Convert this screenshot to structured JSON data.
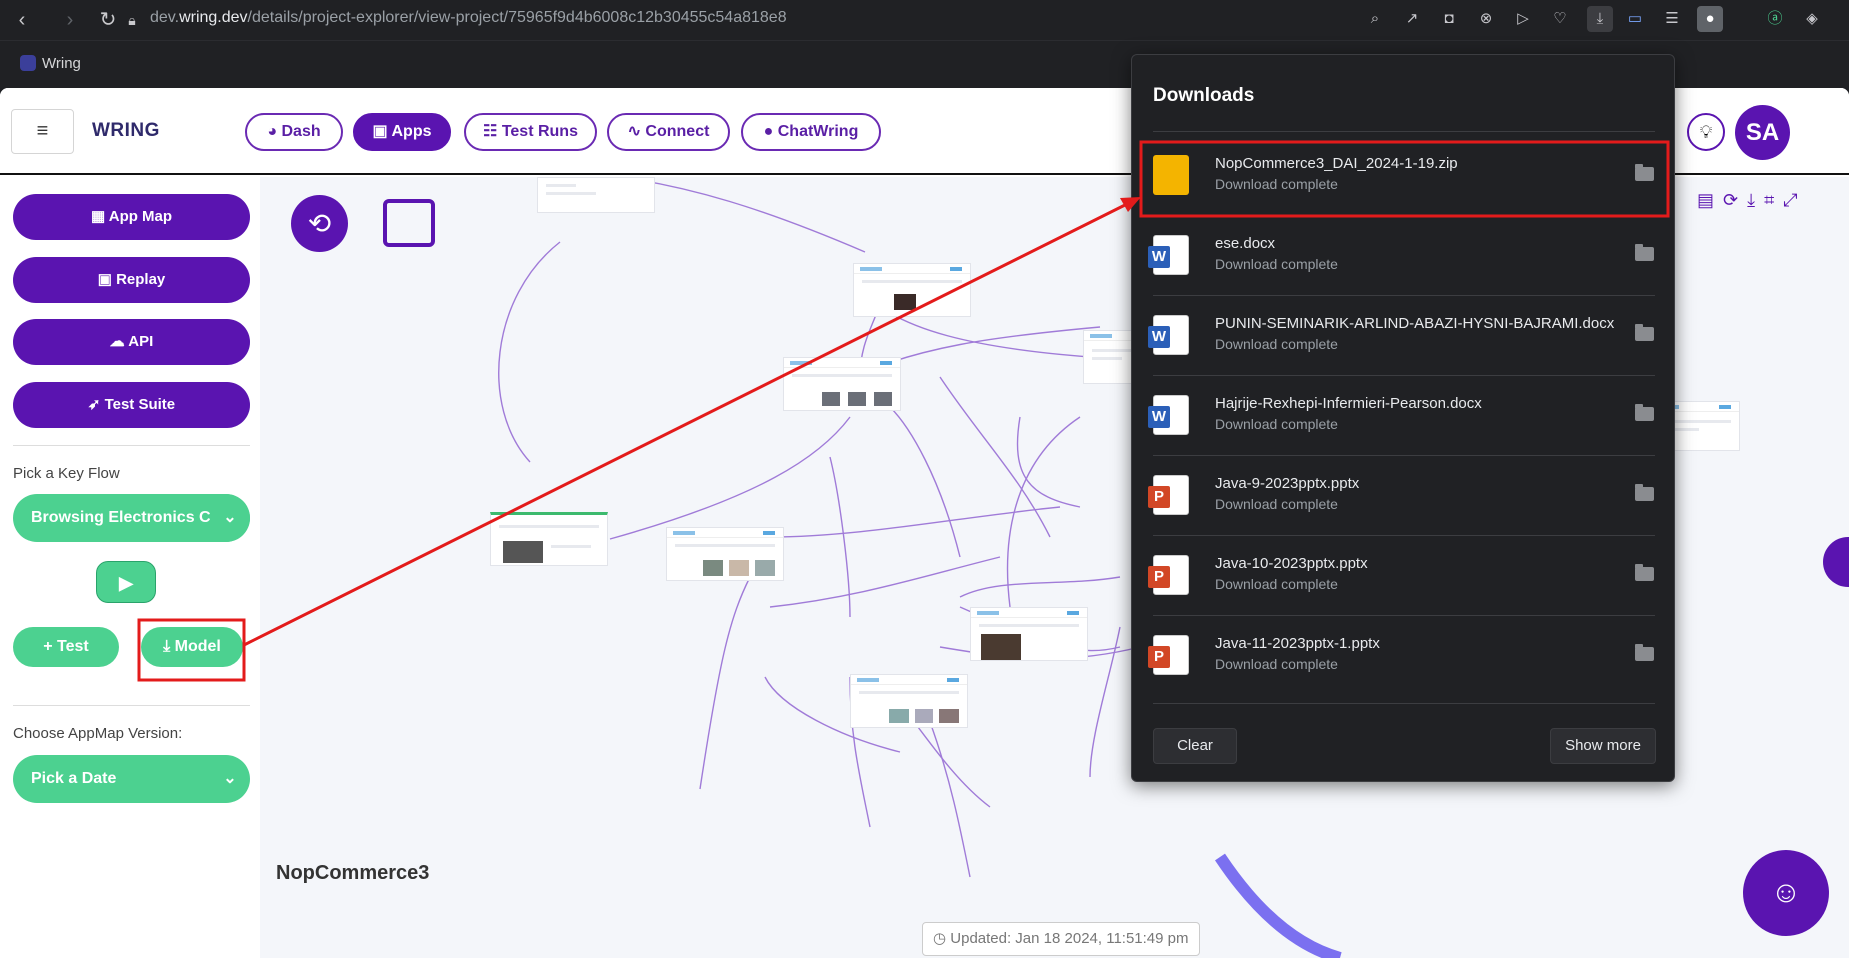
{
  "browser": {
    "url_prefix": "dev.",
    "url_domain": "wring.dev",
    "url_path": "/details/project-explorer/view-project/75965f9d4b6008c12b30455c54a818e8",
    "bookmark": "Wring",
    "profile_icon": "person-icon"
  },
  "app": {
    "brand": "WRING",
    "nav": [
      {
        "label": "Dash",
        "icon": "pie-chart-icon"
      },
      {
        "label": "Apps",
        "icon": "cube-icon"
      },
      {
        "label": "Test Runs",
        "icon": "list-icon"
      },
      {
        "label": "Connect",
        "icon": "pulse-icon"
      },
      {
        "label": "ChatWring",
        "icon": "chat-bubble-icon"
      }
    ],
    "avatar": "SA",
    "accent": "#5a14b0",
    "green": "#4cd190"
  },
  "sidebar": {
    "buttons": [
      "App Map",
      "Replay",
      "API",
      "Test Suite"
    ],
    "pick_flow_label": "Pick a Key Flow",
    "flow_value": "Browsing Electronics Ca",
    "test_label": "Test",
    "model_label": "Model",
    "version_label": "Choose AppMap Version:",
    "date_value": "Pick a Date"
  },
  "canvas": {
    "project_name": "NopCommerce3",
    "updated": "Updated: Jan 18 2024, 11:51:49 pm"
  },
  "downloads": {
    "title": "Downloads",
    "items": [
      {
        "name": "NopCommerce3_DAI_2024-1-19.zip",
        "status": "Download complete",
        "type": "zip"
      },
      {
        "name": "ese.docx",
        "status": "Download complete",
        "type": "docx"
      },
      {
        "name": "PUNIN-SEMINARIK-ARLIND-ABAZI-HYSNI-BAJRAMI.docx",
        "status": "Download complete",
        "type": "docx"
      },
      {
        "name": "Hajrije-Rexhepi-Infermieri-Pearson.docx",
        "status": "Download complete",
        "type": "docx"
      },
      {
        "name": "Java-9-2023pptx.pptx",
        "status": "Download complete",
        "type": "pptx"
      },
      {
        "name": "Java-10-2023pptx.pptx",
        "status": "Download complete",
        "type": "pptx"
      },
      {
        "name": "Java-11-2023pptx-1.pptx",
        "status": "Download complete",
        "type": "pptx"
      }
    ],
    "clear_label": "Clear",
    "more_label": "Show more"
  }
}
